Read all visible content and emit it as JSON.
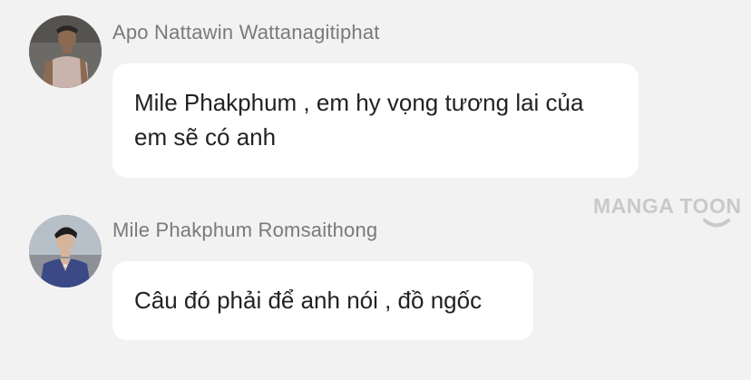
{
  "messages": [
    {
      "sender": "Apo Nattawin Wattanagitiphat",
      "text": "Mile Phakphum , em hy vọng tương lai của em sẽ có anh",
      "avatar": "avatar-apo"
    },
    {
      "sender": "Mile Phakphum Romsaithong",
      "text": "Câu đó phải để anh nói , đồ ngốc",
      "avatar": "avatar-mile"
    }
  ],
  "watermark": {
    "text": "MANGA TOON"
  },
  "colors": {
    "background": "#f2f2f2",
    "bubble": "#ffffff",
    "sender_text": "#7a7a7a",
    "message_text": "#222222",
    "watermark": "#c9c9c9"
  }
}
